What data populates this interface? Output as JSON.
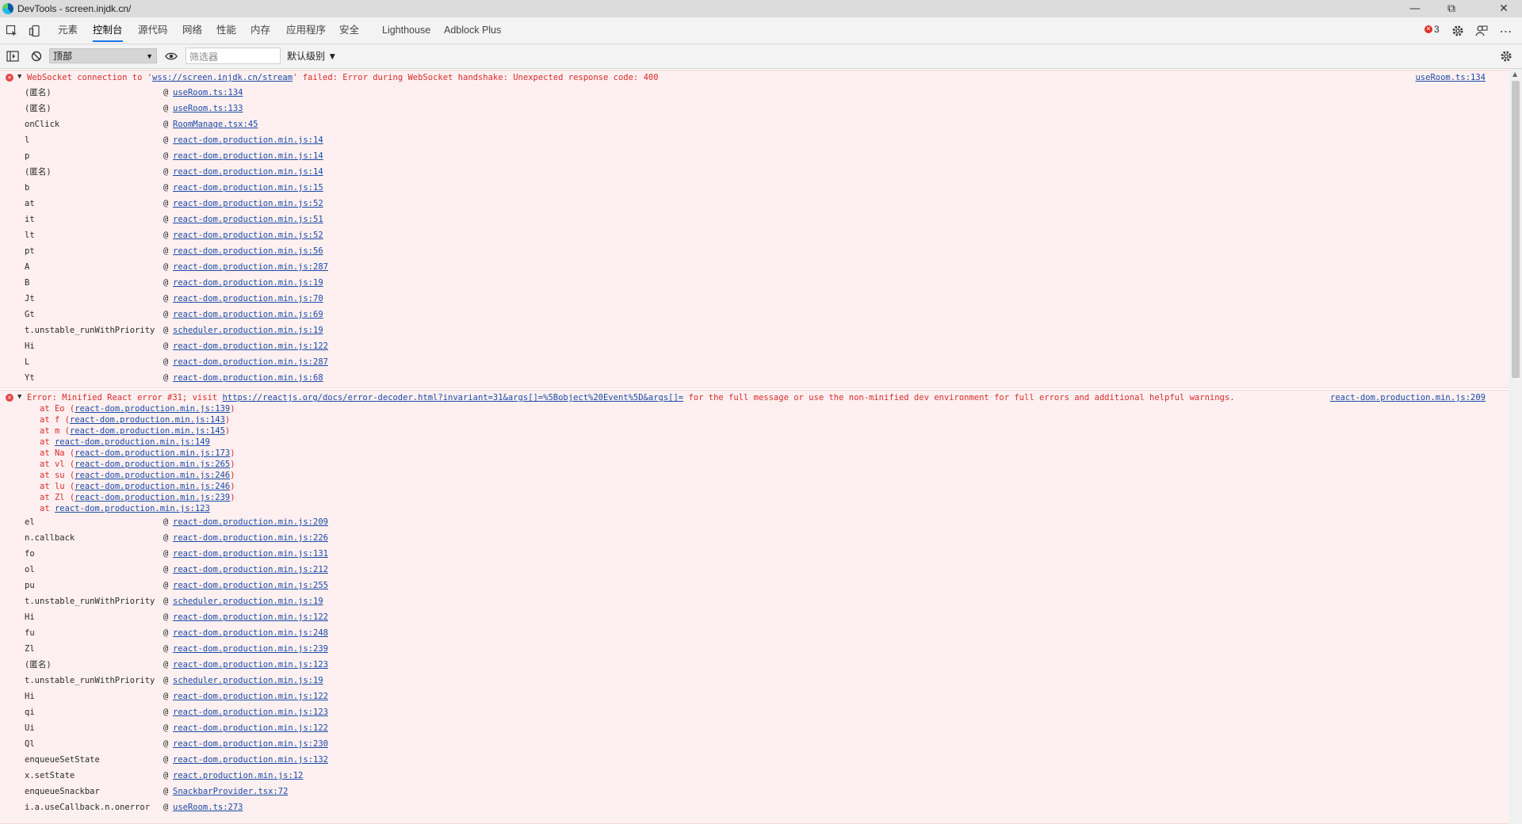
{
  "window": {
    "title": "DevTools - screen.injdk.cn/",
    "minimize_icon": "minimize-icon",
    "restore_icon": "restore-icon",
    "close_icon": "close-icon"
  },
  "tabs": [
    {
      "label": "元素",
      "active": false
    },
    {
      "label": "控制台",
      "active": true
    },
    {
      "label": "源代码",
      "active": false
    },
    {
      "label": "网络",
      "active": false
    },
    {
      "label": "性能",
      "active": false
    },
    {
      "label": "内存",
      "active": false
    },
    {
      "label": "应用程序",
      "active": false
    },
    {
      "label": "安全",
      "active": false
    },
    {
      "label": "Lighthouse",
      "active": false
    },
    {
      "label": "Adblock Plus",
      "active": false
    }
  ],
  "header_right": {
    "error_count": "3"
  },
  "console_toolbar": {
    "context": "顶部",
    "filter_placeholder": "筛选器",
    "levels": "默认级别 ▼"
  },
  "messages": [
    {
      "text_prefix": "WebSocket connection to '",
      "link": "wss://screen.injdk.cn/stream",
      "text_suffix": "' failed: Error during WebSocket handshake: Unexpected response code: 400",
      "source": "useRoom.ts:134",
      "frames": [
        {
          "fn": "(匿名)",
          "loc": "useRoom.ts:134"
        },
        {
          "fn": "(匿名)",
          "loc": "useRoom.ts:133"
        },
        {
          "fn": "onClick",
          "loc": "RoomManage.tsx:45"
        },
        {
          "fn": "l",
          "loc": "react-dom.production.min.js:14"
        },
        {
          "fn": "p",
          "loc": "react-dom.production.min.js:14"
        },
        {
          "fn": "(匿名)",
          "loc": "react-dom.production.min.js:14"
        },
        {
          "fn": "b",
          "loc": "react-dom.production.min.js:15"
        },
        {
          "fn": "at",
          "loc": "react-dom.production.min.js:52"
        },
        {
          "fn": "it",
          "loc": "react-dom.production.min.js:51"
        },
        {
          "fn": "lt",
          "loc": "react-dom.production.min.js:52"
        },
        {
          "fn": "pt",
          "loc": "react-dom.production.min.js:56"
        },
        {
          "fn": "A",
          "loc": "react-dom.production.min.js:287"
        },
        {
          "fn": "B",
          "loc": "react-dom.production.min.js:19"
        },
        {
          "fn": "Jt",
          "loc": "react-dom.production.min.js:70"
        },
        {
          "fn": "Gt",
          "loc": "react-dom.production.min.js:69"
        },
        {
          "fn": "t.unstable_runWithPriority",
          "loc": "scheduler.production.min.js:19"
        },
        {
          "fn": "Hi",
          "loc": "react-dom.production.min.js:122"
        },
        {
          "fn": "L",
          "loc": "react-dom.production.min.js:287"
        },
        {
          "fn": "Yt",
          "loc": "react-dom.production.min.js:68"
        }
      ]
    },
    {
      "text_prefix": "Error: Minified React error #31; visit ",
      "link": "https://reactjs.org/docs/error-decoder.html?invariant=31&args[]=%5Bobject%20Event%5D&args[]=",
      "text_suffix": " for the full message or use the non-minified dev environment for full errors and additional helpful warnings.",
      "source": "react-dom.production.min.js:209",
      "stack": [
        {
          "pre": "at Eo (",
          "loc": "react-dom.production.min.js:139",
          "post": ")"
        },
        {
          "pre": "at f (",
          "loc": "react-dom.production.min.js:143",
          "post": ")"
        },
        {
          "pre": "at m (",
          "loc": "react-dom.production.min.js:145",
          "post": ")"
        },
        {
          "pre": "at ",
          "loc": "react-dom.production.min.js:149",
          "post": ""
        },
        {
          "pre": "at Na (",
          "loc": "react-dom.production.min.js:173",
          "post": ")"
        },
        {
          "pre": "at vl (",
          "loc": "react-dom.production.min.js:265",
          "post": ")"
        },
        {
          "pre": "at su (",
          "loc": "react-dom.production.min.js:246",
          "post": ")"
        },
        {
          "pre": "at lu (",
          "loc": "react-dom.production.min.js:246",
          "post": ")"
        },
        {
          "pre": "at Zl (",
          "loc": "react-dom.production.min.js:239",
          "post": ")"
        },
        {
          "pre": "at ",
          "loc": "react-dom.production.min.js:123",
          "post": ""
        }
      ],
      "frames": [
        {
          "fn": "el",
          "loc": "react-dom.production.min.js:209"
        },
        {
          "fn": "n.callback",
          "loc": "react-dom.production.min.js:226"
        },
        {
          "fn": "fo",
          "loc": "react-dom.production.min.js:131"
        },
        {
          "fn": "ol",
          "loc": "react-dom.production.min.js:212"
        },
        {
          "fn": "pu",
          "loc": "react-dom.production.min.js:255"
        },
        {
          "fn": "t.unstable_runWithPriority",
          "loc": "scheduler.production.min.js:19"
        },
        {
          "fn": "Hi",
          "loc": "react-dom.production.min.js:122"
        },
        {
          "fn": "fu",
          "loc": "react-dom.production.min.js:248"
        },
        {
          "fn": "Zl",
          "loc": "react-dom.production.min.js:239"
        },
        {
          "fn": "(匿名)",
          "loc": "react-dom.production.min.js:123"
        },
        {
          "fn": "t.unstable_runWithPriority",
          "loc": "scheduler.production.min.js:19"
        },
        {
          "fn": "Hi",
          "loc": "react-dom.production.min.js:122"
        },
        {
          "fn": "qi",
          "loc": "react-dom.production.min.js:123"
        },
        {
          "fn": "Ui",
          "loc": "react-dom.production.min.js:122"
        },
        {
          "fn": "Ql",
          "loc": "react-dom.production.min.js:230"
        },
        {
          "fn": "enqueueSetState",
          "loc": "react-dom.production.min.js:132"
        },
        {
          "fn": "x.setState",
          "loc": "react.production.min.js:12"
        },
        {
          "fn": "enqueueSnackbar",
          "loc": "SnackbarProvider.tsx:72"
        },
        {
          "fn": "i.a.useCallback.n.onerror",
          "loc": "useRoom.ts:273"
        }
      ]
    }
  ]
}
